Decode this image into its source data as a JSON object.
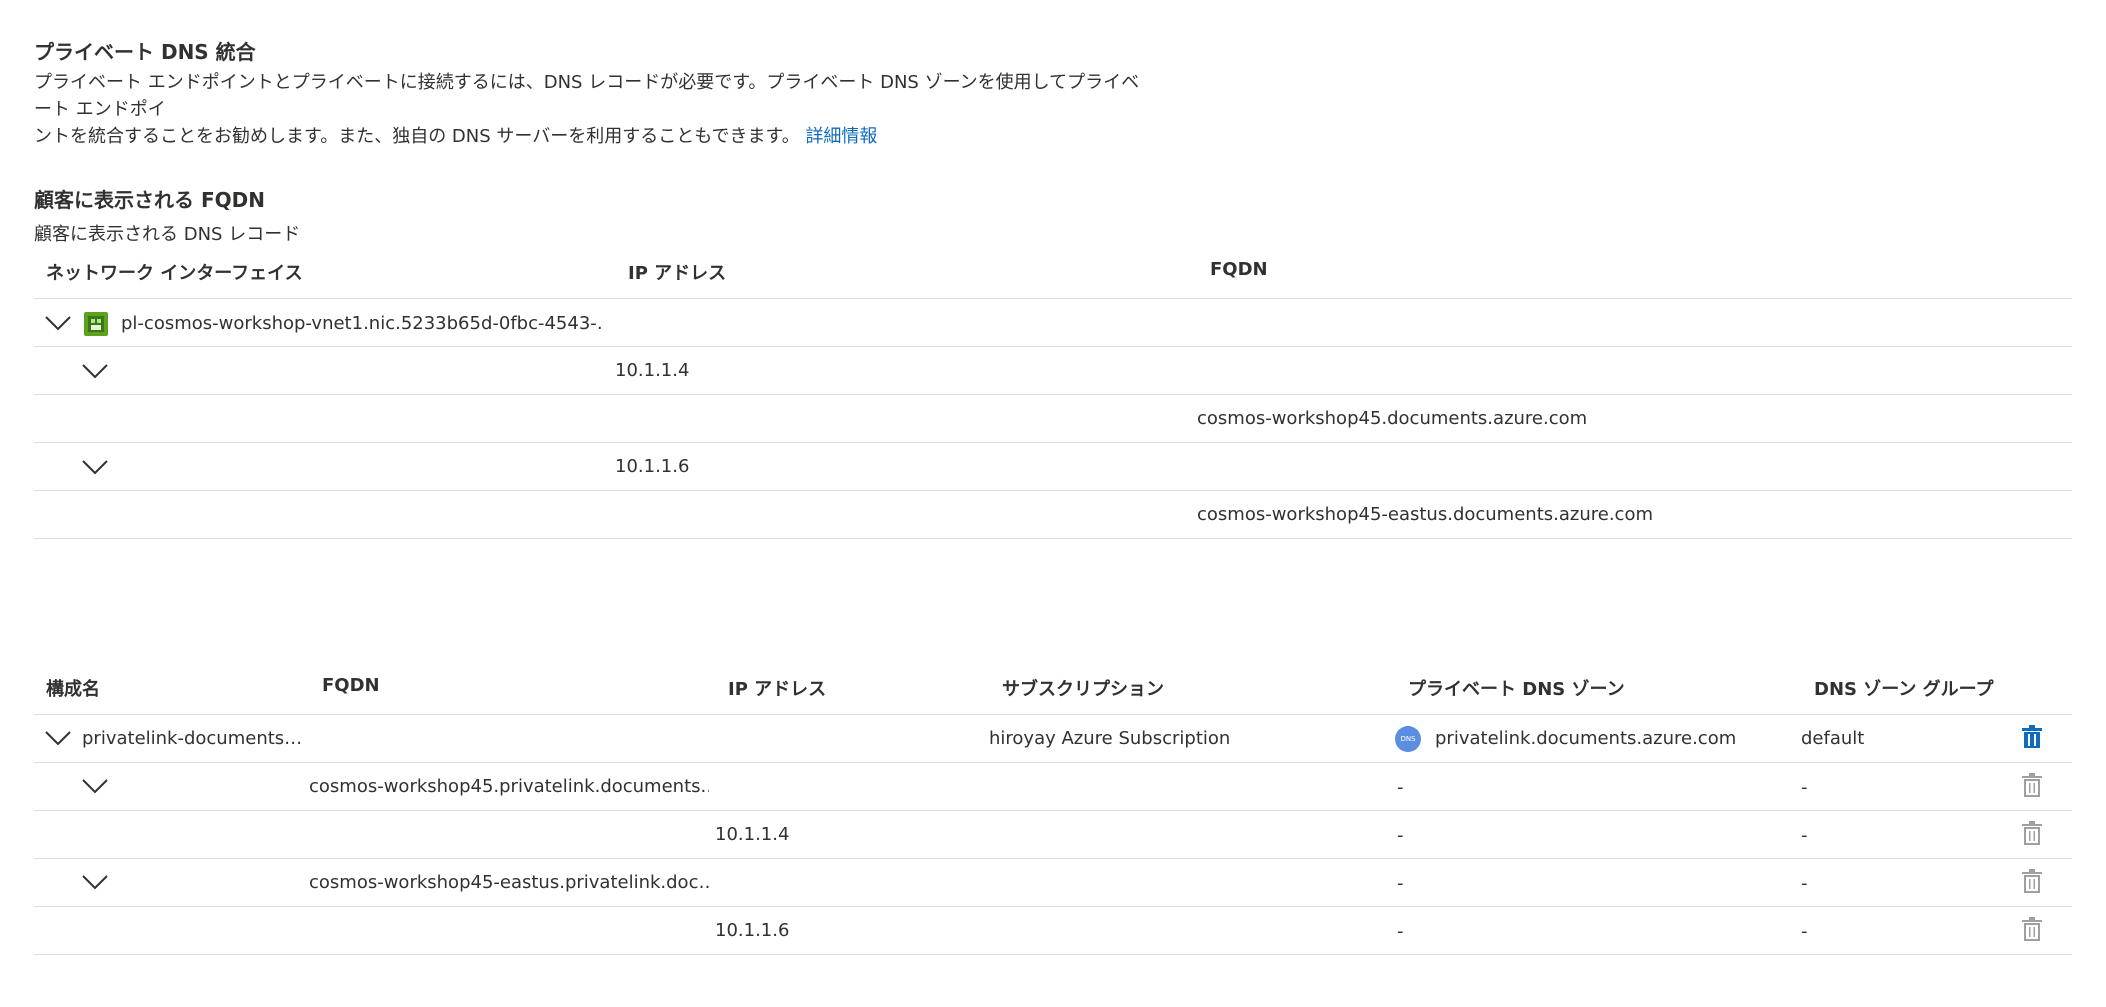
{
  "dns_integration": {
    "title": "プライベート DNS 統合",
    "description_line1": "プライベート エンドポイントとプライベートに接続するには、DNS レコードが必要です。プライベート DNS ゾーンを使用してプライベート エンドポイ",
    "description_line2": "ントを統合することをお勧めします。また、独自の DNS サーバーを利用することもできます。",
    "learn_more": "詳細情報"
  },
  "customer_fqdn": {
    "title": "顧客に表示される FQDN",
    "subtitle": "顧客に表示される DNS レコード",
    "headers": {
      "nic": "ネットワーク インターフェイス",
      "ip": "IP アドレス",
      "fqdn": "FQDN"
    },
    "nic_name": "pl-cosmos-workshop-vnet1.nic.5233b65d-0fbc-4543-…",
    "entries": [
      {
        "ip": "10.1.1.4",
        "fqdn": "cosmos-workshop45.documents.azure.com"
      },
      {
        "ip": "10.1.1.6",
        "fqdn": "cosmos-workshop45-eastus.documents.azure.com"
      }
    ]
  },
  "config": {
    "headers": {
      "name": "構成名",
      "fqdn": "FQDN",
      "ip": "IP アドレス",
      "subscription": "サブスクリプション",
      "zone": "プライベート DNS ゾーン",
      "zone_group": "DNS ゾーン グループ"
    },
    "config_name": "privatelink-documents…",
    "subscription": "hiroyay Azure Subscription",
    "zone_icon_text": "DNS",
    "zone": "privatelink.documents.azure.com",
    "zone_group": "default",
    "dash": "-",
    "fqdn_rows": [
      {
        "fqdn": "cosmos-workshop45.privatelink.documents.…",
        "ip": "10.1.1.4"
      },
      {
        "fqdn": "cosmos-workshop45-eastus.privatelink.doc…",
        "ip": "10.1.1.6"
      }
    ]
  },
  "icons": {
    "expand": "chevron-down-icon",
    "nic": "network-interface-icon",
    "dns_zone": "dns-zone-icon",
    "delete": "trash-icon"
  },
  "colors": {
    "link": "#0f6cbd",
    "text": "#323130",
    "divider": "#e1dfdd",
    "trash_active": "#0f6cbd",
    "trash_disabled": "#a19f9d"
  }
}
